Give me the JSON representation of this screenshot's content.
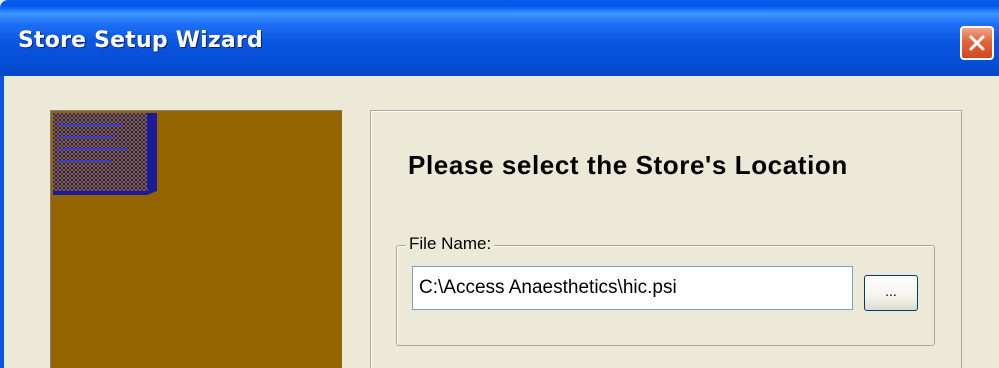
{
  "window": {
    "title": "Store Setup Wizard",
    "close_icon": "close-icon"
  },
  "colors": {
    "titlebar_blue": "#0a55e0",
    "image_panel_brown": "#946400",
    "dialog_face": "#ece9d8",
    "close_red": "#d2461f"
  },
  "illustration": {
    "icon": "store-book-icon"
  },
  "main": {
    "heading": "Please select the Store's Location",
    "file_group": {
      "label": "File Name:",
      "path_value": "C:\\Access Anaesthetics\\hic.psi",
      "browse_label": "..."
    }
  }
}
